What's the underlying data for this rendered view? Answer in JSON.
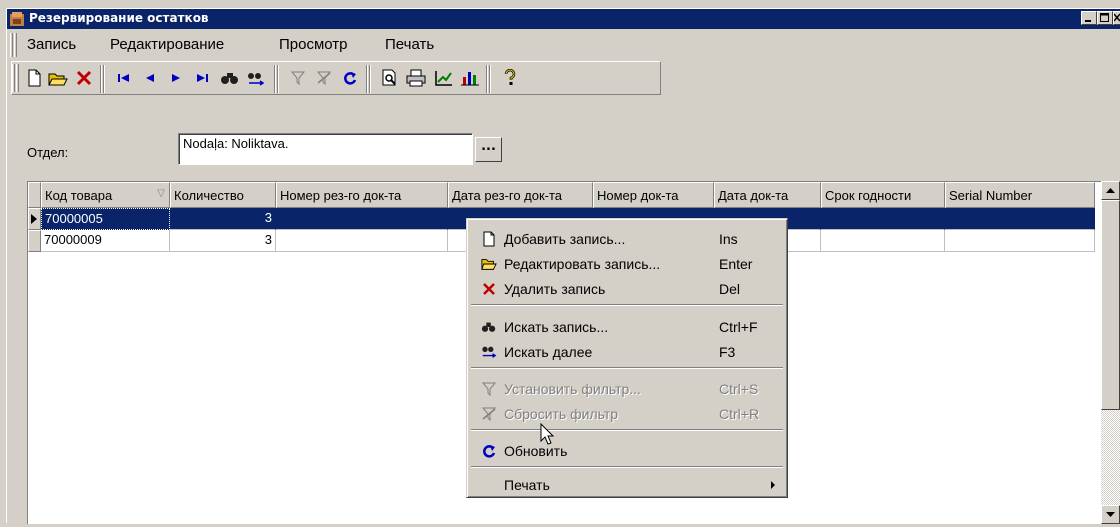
{
  "window": {
    "title": "Резервирование остатков"
  },
  "menubar": [
    "Запись",
    "Редактирование",
    "Просмотр",
    "Печать"
  ],
  "toolbar": {
    "icons": [
      "new-doc-icon",
      "open-folder-icon",
      "delete-icon",
      "first-record-icon",
      "prev-record-icon",
      "next-record-icon",
      "last-record-icon",
      "find-icon",
      "find-next-icon",
      "set-filter-icon",
      "reset-filter-icon",
      "refresh-icon",
      "preview-icon",
      "print-icon",
      "chart-edit-icon",
      "chart-icon",
      "help-icon"
    ]
  },
  "department": {
    "label": "Отдел:",
    "value": "Nodaļa: Noliktava.",
    "button": "..."
  },
  "grid": {
    "columns": [
      "Код товара",
      "Количество",
      "Номер рез-го док-та",
      "Дата рез-го док-та",
      "Номер док-та",
      "Дата док-та",
      "Срок годности",
      "Serial Number"
    ],
    "rows": [
      [
        "70000005",
        "3",
        "",
        "",
        "",
        "",
        "",
        ""
      ],
      [
        "70000009",
        "3",
        "",
        "",
        "",
        "",
        "",
        ""
      ]
    ],
    "selected_row": 0
  },
  "context_menu": {
    "items": [
      {
        "label": "Добавить запись...",
        "shortcut": "Ins",
        "icon": "new-doc-icon",
        "enabled": true
      },
      {
        "label": "Редактировать запись...",
        "shortcut": "Enter",
        "icon": "open-folder-icon",
        "enabled": true
      },
      {
        "label": "Удалить запись",
        "shortcut": "Del",
        "icon": "delete-icon",
        "enabled": true
      },
      {
        "label": "Искать запись...",
        "shortcut": "Ctrl+F",
        "icon": "find-icon",
        "enabled": true
      },
      {
        "label": "Искать далее",
        "shortcut": "F3",
        "icon": "find-next-icon",
        "enabled": true
      },
      {
        "label": "Установить фильтр...",
        "shortcut": "Ctrl+S",
        "icon": "set-filter-icon",
        "enabled": false
      },
      {
        "label": "Сбросить фильтр",
        "shortcut": "Ctrl+R",
        "icon": "reset-filter-icon",
        "enabled": false
      },
      {
        "label": "Обновить",
        "shortcut": "",
        "icon": "refresh-icon",
        "enabled": true
      },
      {
        "label": "Печать",
        "shortcut": "",
        "icon": "",
        "enabled": true,
        "submenu": true
      }
    ]
  },
  "colors": {
    "titlebar": "#0a246a",
    "face": "#d4d0c8",
    "selection": "#0a246a"
  }
}
